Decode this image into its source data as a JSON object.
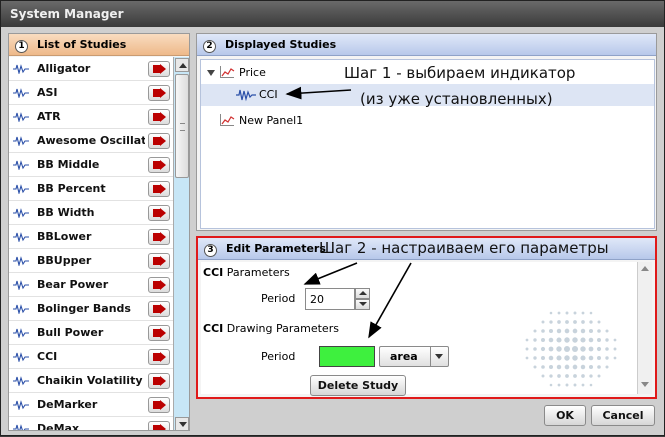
{
  "window": {
    "title": "System Manager"
  },
  "list_panel": {
    "number": "1",
    "title": "List of Studies",
    "items": [
      "Alligator",
      "ASI",
      "ATR",
      "Awesome Oscillator",
      "BB Middle",
      "BB Percent",
      "BB Width",
      "BBLower",
      "BBUpper",
      "Bear Power",
      "Bolinger Bands",
      "Bull Power",
      "CCI",
      "Chaikin Volatility",
      "DeMarker",
      "DeMax"
    ]
  },
  "displayed_panel": {
    "number": "2",
    "title": "Displayed Studies",
    "tree": {
      "price": "Price",
      "cci": "CCI",
      "new_panel": "New Panel1"
    }
  },
  "annotations": {
    "step1_line1": "Шаг 1 - выбираем индикатор",
    "step1_line2": "(из уже установленных)",
    "step2": "Шаг 2 - настраиваем его параметры"
  },
  "edit_panel": {
    "number": "3",
    "title": "Edit Parameters",
    "params_prefix": "CCI",
    "params_title": "Parameters",
    "period_label": "Period",
    "period_value": "20",
    "drawing_prefix": "CCI",
    "drawing_title": "Drawing Parameters",
    "drawing_period_label": "Period",
    "line_color": "#3ef03e",
    "style_value": "area",
    "delete_label": "Delete Study"
  },
  "buttons": {
    "ok": "OK",
    "cancel": "Cancel"
  }
}
